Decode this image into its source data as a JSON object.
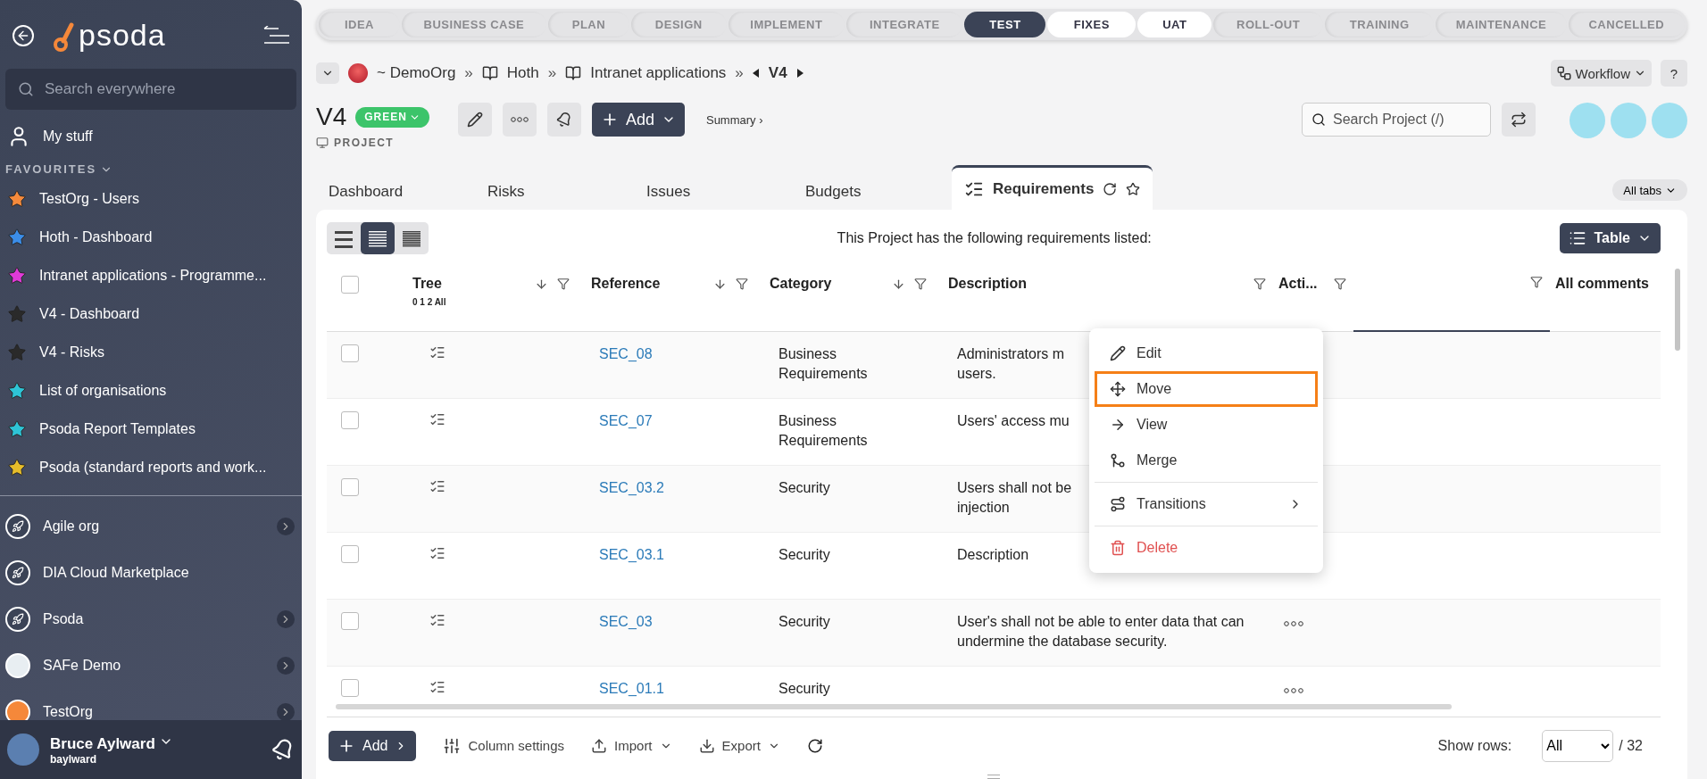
{
  "sidebar": {
    "logo": "psoda",
    "search": {
      "placeholder": "Search everywhere"
    },
    "my_stuff": "My stuff",
    "favourites_heading": "FAVOURITES",
    "favourites": [
      {
        "label": "TestOrg - Users",
        "color": "#f58a3c"
      },
      {
        "label": "Hoth - Dashboard",
        "color": "#3b8de8"
      },
      {
        "label": "Intranet applications - Programme...",
        "color": "#e03ad8"
      },
      {
        "label": "V4 - Dashboard",
        "color": "#2a2a2a"
      },
      {
        "label": "V4 - Risks",
        "color": "#2a2a2a"
      },
      {
        "label": "List of organisations",
        "color": "#2ec4d6"
      },
      {
        "label": "Psoda Report Templates",
        "color": "#2ec4d6"
      },
      {
        "label": "Psoda (standard reports and work...",
        "color": "#e6bd2a"
      }
    ],
    "organisations": [
      {
        "label": "Agile org",
        "kind": "rocket",
        "has_children": true
      },
      {
        "label": "DIA Cloud Marketplace",
        "kind": "rocket",
        "has_children": false
      },
      {
        "label": "Psoda",
        "kind": "rocket",
        "has_children": true
      },
      {
        "label": "SAFe Demo",
        "kind": "stripes",
        "has_children": true
      },
      {
        "label": "TestOrg",
        "kind": "sun",
        "has_children": true
      }
    ],
    "user": {
      "name": "Bruce Aylward",
      "username": "baylward"
    }
  },
  "phases": [
    {
      "label": "IDEA",
      "selected": false,
      "available": false
    },
    {
      "label": "BUSINESS CASE",
      "selected": false,
      "available": false
    },
    {
      "label": "PLAN",
      "selected": false,
      "available": false
    },
    {
      "label": "DESIGN",
      "selected": false,
      "available": false
    },
    {
      "label": "IMPLEMENT",
      "selected": false,
      "available": false
    },
    {
      "label": "INTEGRATE",
      "selected": false,
      "available": false
    },
    {
      "label": "TEST",
      "selected": true,
      "available": false
    },
    {
      "label": "FIXES",
      "selected": false,
      "available": true
    },
    {
      "label": "UAT",
      "selected": false,
      "available": true
    },
    {
      "label": "ROLL-OUT",
      "selected": false,
      "available": false
    },
    {
      "label": "TRAINING",
      "selected": false,
      "available": false
    },
    {
      "label": "MAINTENANCE",
      "selected": false,
      "available": false
    },
    {
      "label": "CANCELLED",
      "selected": false,
      "available": false
    }
  ],
  "breadcrumb": {
    "items": [
      {
        "label": "~ DemoOrg",
        "kind": "org",
        "separator": "»"
      },
      {
        "label": "Hoth",
        "kind": "book",
        "separator": "»"
      },
      {
        "label": "Intranet applications",
        "kind": "book",
        "separator": "»"
      }
    ],
    "current": "V4"
  },
  "workflow_button": "Workflow",
  "help_button": "?",
  "project": {
    "title": "V4",
    "status": "GREEN",
    "type_label": "PROJECT",
    "add_button": "Add",
    "summary_link": "Summary ›",
    "search": {
      "placeholder": "Search Project (/)"
    }
  },
  "tabs": [
    {
      "label": "Dashboard",
      "selected": false
    },
    {
      "label": "Risks",
      "selected": false
    },
    {
      "label": "Issues",
      "selected": false
    },
    {
      "label": "Budgets",
      "selected": false
    },
    {
      "label": "Requirements",
      "selected": true
    }
  ],
  "all_tabs": "All tabs",
  "view_modes": [
    {
      "kind": "wide",
      "selected": false
    },
    {
      "kind": "normal",
      "selected": true
    },
    {
      "kind": "dense",
      "selected": false
    }
  ],
  "intro": "This Project has the following requirements listed:",
  "view_button": "Table",
  "table": {
    "tree_levels": "0 1 2 All",
    "all_checked": false,
    "columns": [
      {
        "label": "Tree",
        "sortable": true,
        "filterable": true
      },
      {
        "label": "Reference",
        "sortable": true,
        "filterable": true
      },
      {
        "label": "Category",
        "sortable": true,
        "filterable": true
      },
      {
        "label": "Description",
        "sortable": false,
        "filterable": true
      },
      {
        "label": "Acti...",
        "sortable": false,
        "filterable": true
      },
      {
        "filterable": true
      },
      {
        "label": "All comments",
        "sortable": false,
        "filterable": false
      }
    ],
    "rows": [
      {
        "checked": false,
        "reference": "SEC_08",
        "category": "Business Requirements",
        "description": [
          "Administrators m",
          "users."
        ]
      },
      {
        "checked": false,
        "reference": "SEC_07",
        "category": "Business Requirements",
        "description": [
          "Users' access mu"
        ]
      },
      {
        "checked": false,
        "reference": "SEC_03.2",
        "category": "Security",
        "description": [
          "Users shall not be",
          "injection"
        ]
      },
      {
        "checked": false,
        "reference": "SEC_03.1",
        "category": "Security",
        "description": [
          "Description"
        ]
      },
      {
        "checked": false,
        "reference": "SEC_03",
        "category": "Security",
        "description": [
          "User's shall not be able to enter data that can undermine the database security."
        ]
      },
      {
        "checked": false,
        "reference": "SEC_01.1",
        "category": "Security",
        "description": []
      }
    ]
  },
  "context_menu": {
    "items": [
      {
        "label": "Edit",
        "kind": "edit",
        "highlighted": false
      },
      {
        "label": "Move",
        "kind": "move",
        "highlighted": true
      },
      {
        "label": "View",
        "kind": "view",
        "highlighted": false
      },
      {
        "label": "Merge",
        "kind": "merge",
        "highlighted": false
      },
      {
        "label": "Transitions",
        "kind": "transitions",
        "highlighted": false
      },
      {
        "label": "Delete",
        "kind": "delete",
        "highlighted": false
      }
    ]
  },
  "footer": {
    "add": "Add",
    "column_settings": "Column settings",
    "import": "Import",
    "export": "Export",
    "show_rows_label": "Show rows:",
    "show_rows_value": "All",
    "total": "/ 32"
  }
}
